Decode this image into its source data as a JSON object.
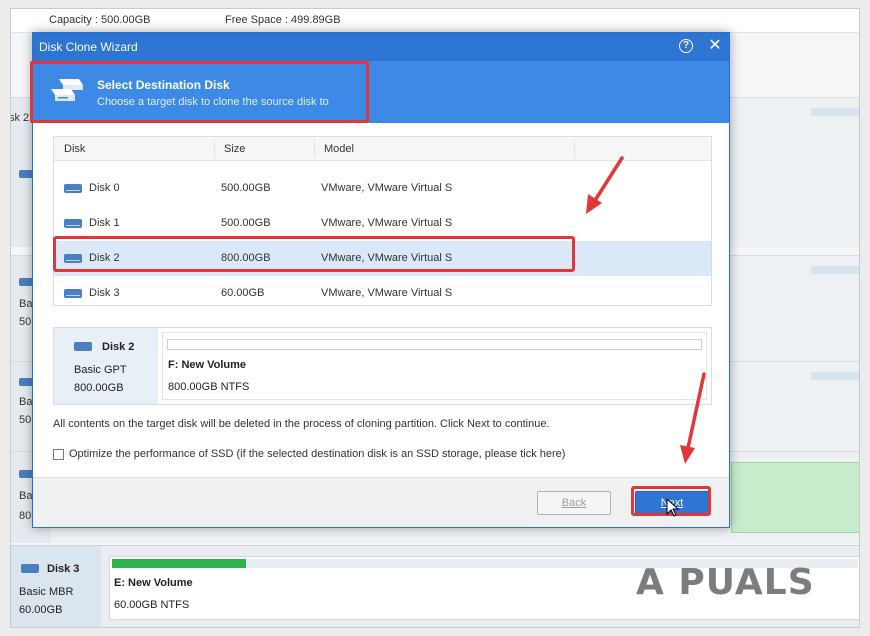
{
  "background_app": {
    "capacity_text": "Capacity : 500.00GB",
    "free_space_text": "Free Space : 499.89GB",
    "left_fragments": [
      "sk 2",
      "Bas",
      "50",
      "Bas",
      "50",
      "Bas",
      "80"
    ],
    "disk3": {
      "name": "Disk 3",
      "type": "Basic MBR",
      "size": "60.00GB",
      "volume": "E: New Volume",
      "fs": "60.00GB NTFS",
      "used_fraction": 0.18
    }
  },
  "watermark": "A PUALS",
  "dialog": {
    "title": "Disk Clone Wizard",
    "help_icon": "question-circle-icon",
    "close_icon": "close-icon",
    "header": {
      "title": "Select Destination Disk",
      "subtitle": "Choose a target disk to clone the source disk to"
    },
    "columns": [
      "Disk",
      "Size",
      "Model"
    ],
    "disks": [
      {
        "disk": "Disk 0",
        "size": "500.00GB",
        "model": "VMware, VMware Virtual S"
      },
      {
        "disk": "Disk 1",
        "size": "500.00GB",
        "model": "VMware, VMware Virtual S"
      },
      {
        "disk": "Disk 2",
        "size": "800.00GB",
        "model": "VMware, VMware Virtual S"
      },
      {
        "disk": "Disk 3",
        "size": "60.00GB",
        "model": "VMware, VMware Virtual S"
      }
    ],
    "selected_index": 2,
    "selected_disk": {
      "name": "Disk 2",
      "type": "Basic GPT",
      "size": "800.00GB",
      "volume": "F: New Volume",
      "fs": "800.00GB NTFS"
    },
    "warning": "All contents on the target disk will be deleted in the process of cloning partition. Click Next to continue.",
    "ssd_option": {
      "label": "Optimize the performance of SSD (if the selected destination disk is an SSD storage, please tick here)",
      "checked": false
    },
    "buttons": {
      "back": "Back",
      "next": "Next"
    }
  },
  "colors": {
    "title_bar": "#2d74d3",
    "header": "#3d89e6",
    "highlight": "#e33636",
    "selected_row": "#dbe8f7",
    "used_bar": "#2fb24d"
  }
}
